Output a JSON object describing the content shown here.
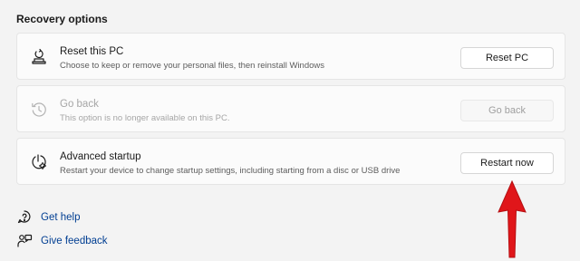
{
  "section_title": "Recovery options",
  "items": [
    {
      "title": "Reset this PC",
      "description": "Choose to keep or remove your personal files, then reinstall Windows",
      "button": "Reset PC",
      "icon": "reset-pc-icon"
    },
    {
      "title": "Go back",
      "description": "This option is no longer available on this PC.",
      "button": "Go back",
      "icon": "history-icon",
      "disabled": true
    },
    {
      "title": "Advanced startup",
      "description": "Restart your device to change startup settings, including starting from a disc or USB drive",
      "button": "Restart now",
      "icon": "advanced-startup-icon"
    }
  ],
  "links": [
    {
      "label": "Get help",
      "icon": "help-icon"
    },
    {
      "label": "Give feedback",
      "icon": "feedback-icon"
    }
  ],
  "colors": {
    "background": "#f3f3f3",
    "card": "#fbfbfb",
    "link": "#003e92",
    "annotation_arrow": "#e0161a"
  }
}
